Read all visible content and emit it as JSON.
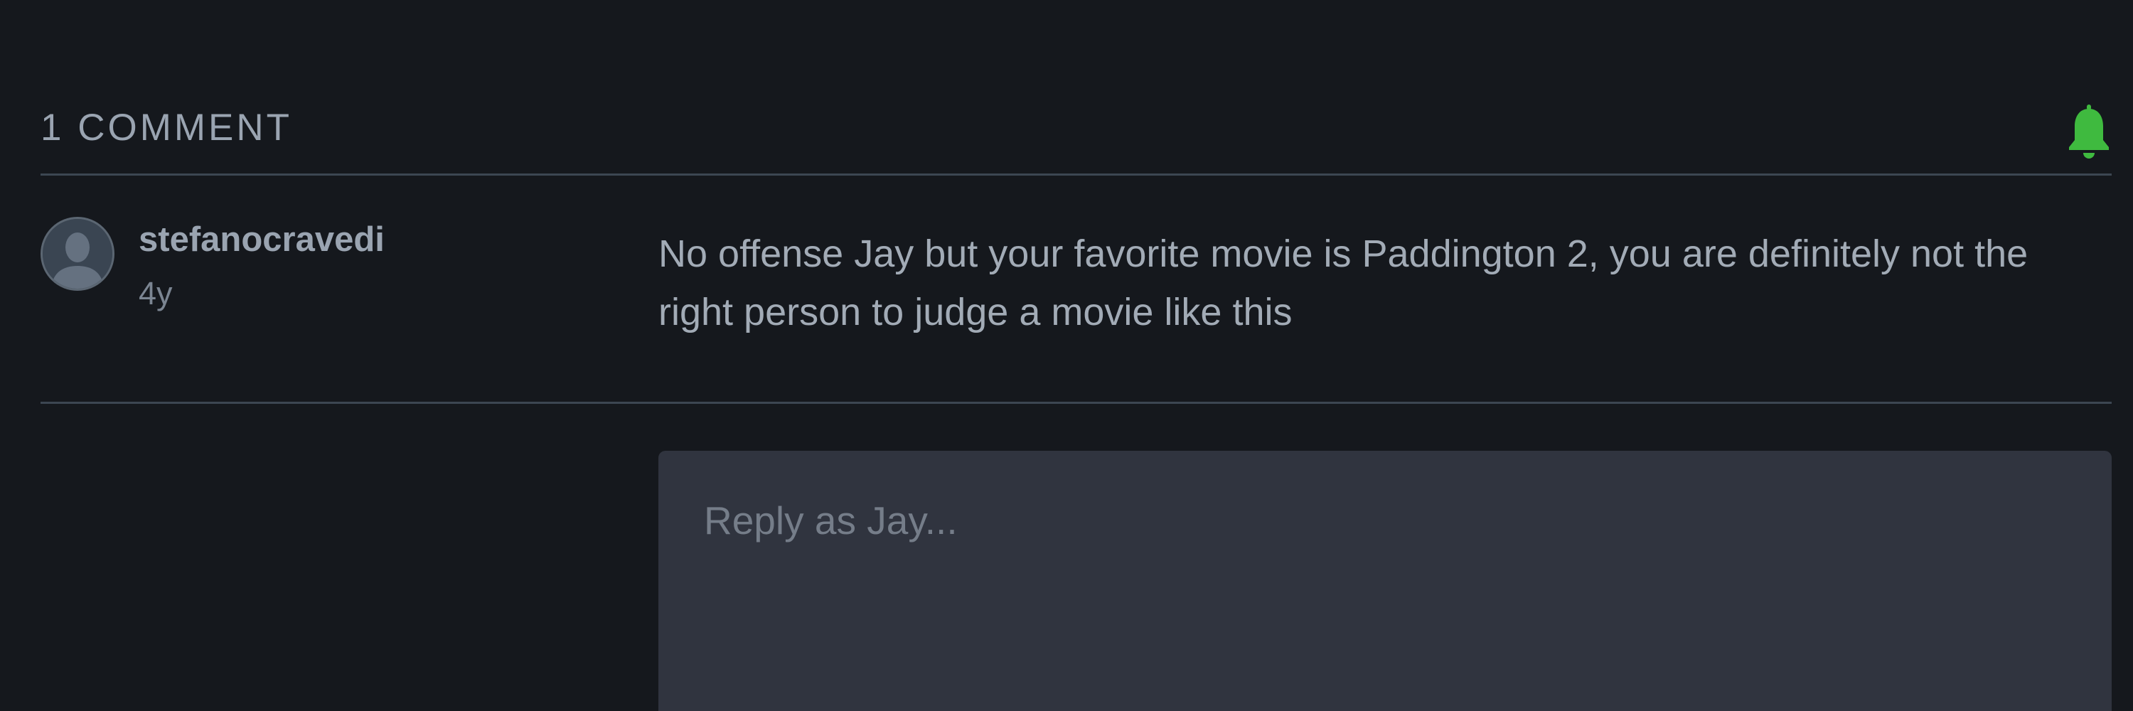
{
  "comments_section": {
    "count_label": "1 COMMENT",
    "notify_icon": "bell-icon",
    "accent_color": "#3fba3f"
  },
  "comments": [
    {
      "username": "stefanocravedi",
      "time_ago": "4y",
      "avatar_icon": "default-user-avatar",
      "text": "No offense Jay but your favorite movie is Paddington 2, you are definitely not the right person to judge a movie like this"
    }
  ],
  "reply": {
    "placeholder": "Reply as Jay..."
  }
}
